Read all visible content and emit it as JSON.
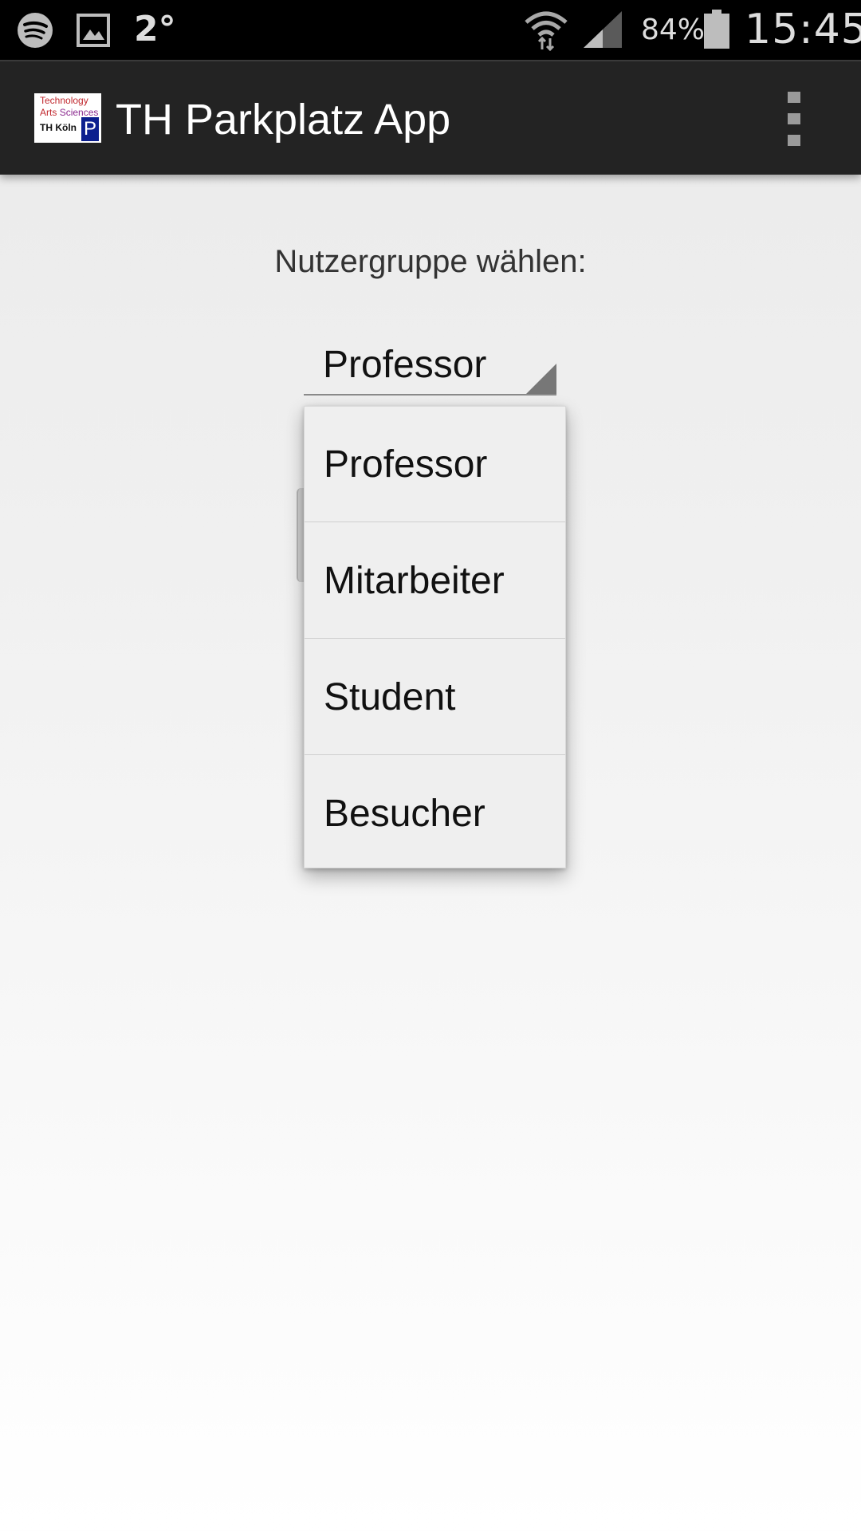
{
  "status_bar": {
    "icons": [
      "spotify-icon",
      "gallery-icon",
      "wifi-icon",
      "signal-icon",
      "battery-icon"
    ],
    "temperature": "2°",
    "battery_percent": "84%",
    "battery_level": 0.84,
    "time": "15:45"
  },
  "action_bar": {
    "logo_lines": [
      "Technology",
      "Arts",
      "Sciences",
      "TH Köln",
      "P"
    ],
    "title": "TH Parkplatz App",
    "overflow_icon": "more-vert-icon"
  },
  "content": {
    "group_label": "Nutzergruppe wählen:",
    "spinner_selected": "Professor"
  },
  "dropdown": {
    "options": [
      "Professor",
      "Mitarbeiter",
      "Student",
      "Besucher"
    ]
  },
  "colors": {
    "status_bar_bg": "#000000",
    "action_bar_bg": "#232323",
    "dropdown_bg": "#efefef",
    "logo_red": "#c0272d",
    "logo_purple": "#8b2a8f",
    "logo_blue": "#0c1f8e"
  }
}
